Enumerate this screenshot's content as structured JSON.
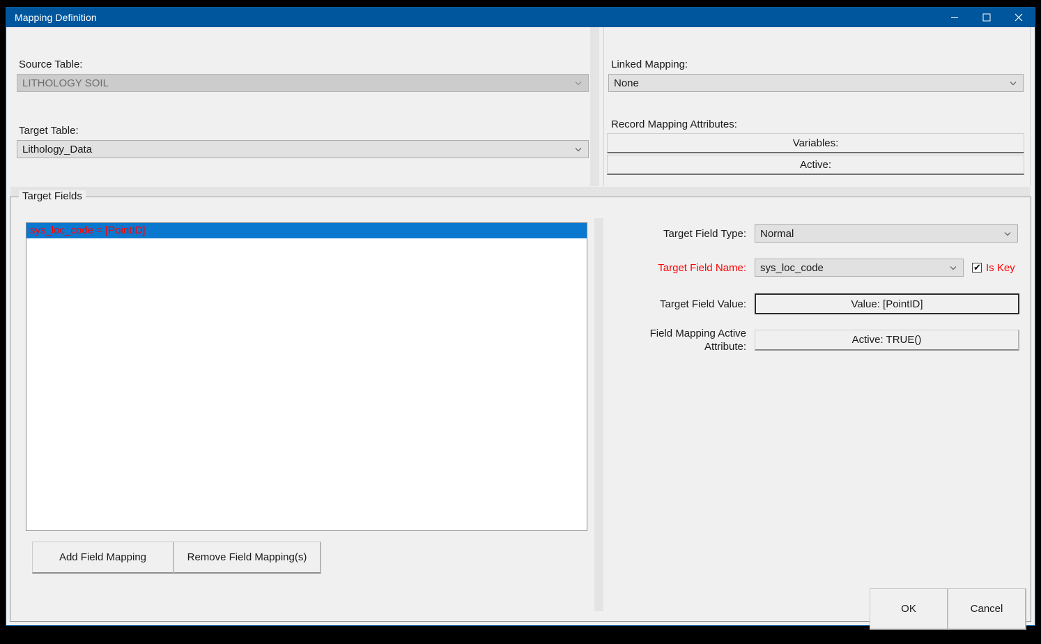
{
  "window": {
    "title": "Mapping Definition",
    "controls": {
      "minimize": "minimize-icon",
      "maximize": "maximize-icon",
      "close": "close-icon"
    },
    "titlebar_color": "#00569c"
  },
  "top_left": {
    "source_table_label": "Source Table:",
    "source_table_value": "LITHOLOGY SOIL",
    "target_table_label": "Target Table:",
    "target_table_value": "Lithology_Data"
  },
  "top_right": {
    "linked_mapping_label": "Linked Mapping:",
    "linked_mapping_value": "None",
    "record_mapping_attributes_label": "Record Mapping Attributes:",
    "variables_button": "Variables:",
    "active_button": "Active:"
  },
  "target_fields": {
    "group_title": "Target Fields",
    "list_items": [
      {
        "text": "sys_loc_code = [PointID]",
        "selected": true
      }
    ],
    "add_button": "Add Field Mapping",
    "remove_button": "Remove Field Mapping(s)"
  },
  "detail": {
    "target_field_type_label": "Target Field Type:",
    "target_field_type_value": "Normal",
    "target_field_name_label": "Target Field Name:",
    "target_field_name_value": "sys_loc_code",
    "is_key_label": "Is Key",
    "is_key_checked": true,
    "target_field_value_label": "Target Field Value:",
    "target_field_value_button": "Value: [PointID]",
    "field_mapping_active_label_line1": "Field Mapping Active",
    "field_mapping_active_label_line2": "Attribute:",
    "field_mapping_active_button": "Active: TRUE()"
  },
  "footer": {
    "ok_label": "OK",
    "cancel_label": "Cancel"
  },
  "colors": {
    "accent": "#00569c",
    "selection": "#0b78d0",
    "required_red": "#ff0000",
    "dialog_bg": "#f0f0f0"
  }
}
